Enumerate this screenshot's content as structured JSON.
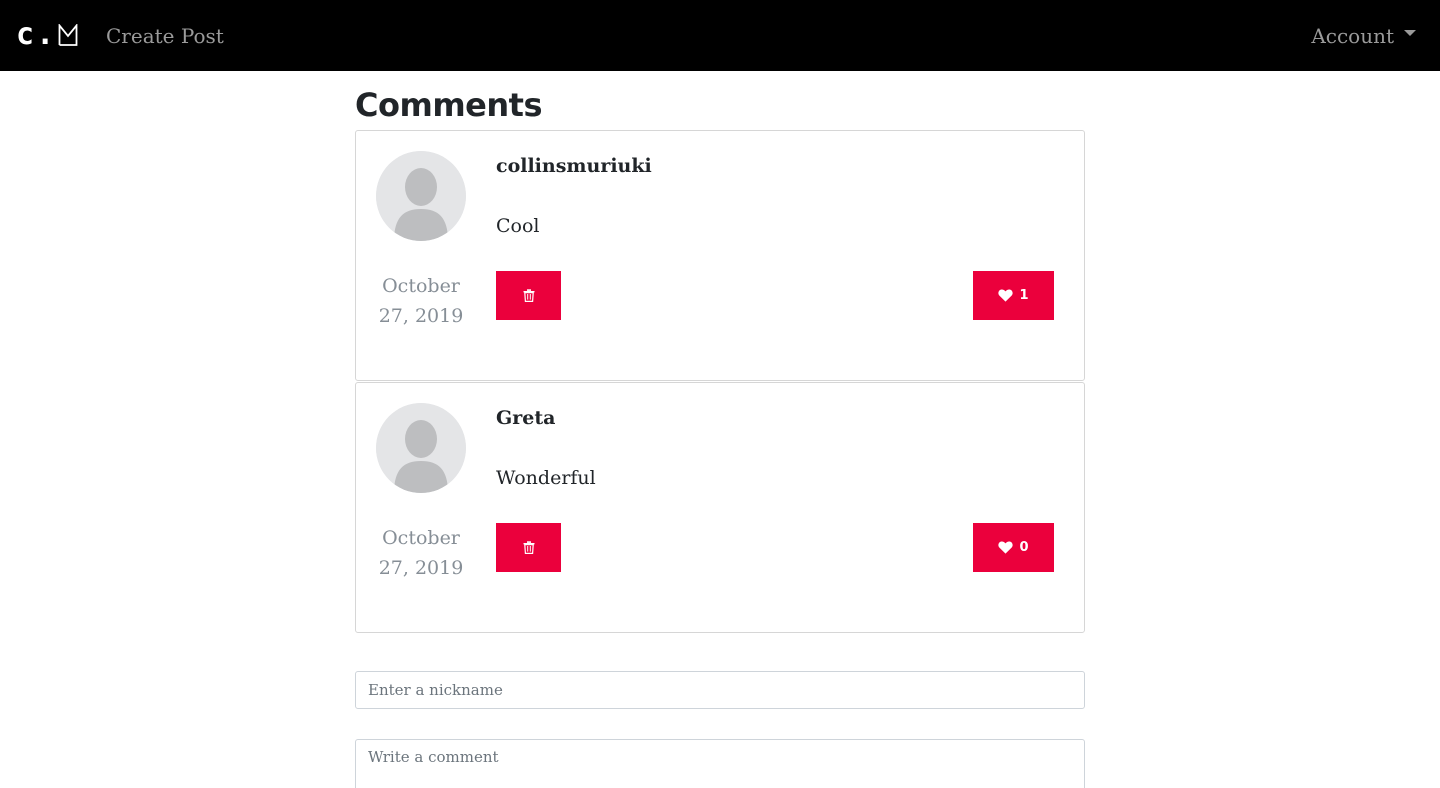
{
  "navbar": {
    "brand_c": "c",
    "brand_dot": ".",
    "create_post": "Create Post",
    "account": "Account"
  },
  "main": {
    "heading": "Comments",
    "comments": [
      {
        "author": "collinsmuriuki",
        "text": "Cool",
        "date_line1": "October",
        "date_line2": "27, 2019",
        "likes": "1"
      },
      {
        "author": "Greta",
        "text": "Wonderful",
        "date_line1": "October",
        "date_line2": "27, 2019",
        "likes": "0"
      }
    ]
  },
  "form": {
    "nickname_placeholder": "Enter a nickname",
    "comment_placeholder": "Write a comment"
  },
  "icons": {
    "delete": "trash-icon",
    "like": "heart-icon",
    "avatar": "user-silhouette-icon",
    "dropdown": "caret-down-icon"
  },
  "colors": {
    "navbar_bg": "#000000",
    "accent": "#eb003c",
    "muted_text": "#868e96",
    "avatar_bg": "#e4e5e7"
  }
}
